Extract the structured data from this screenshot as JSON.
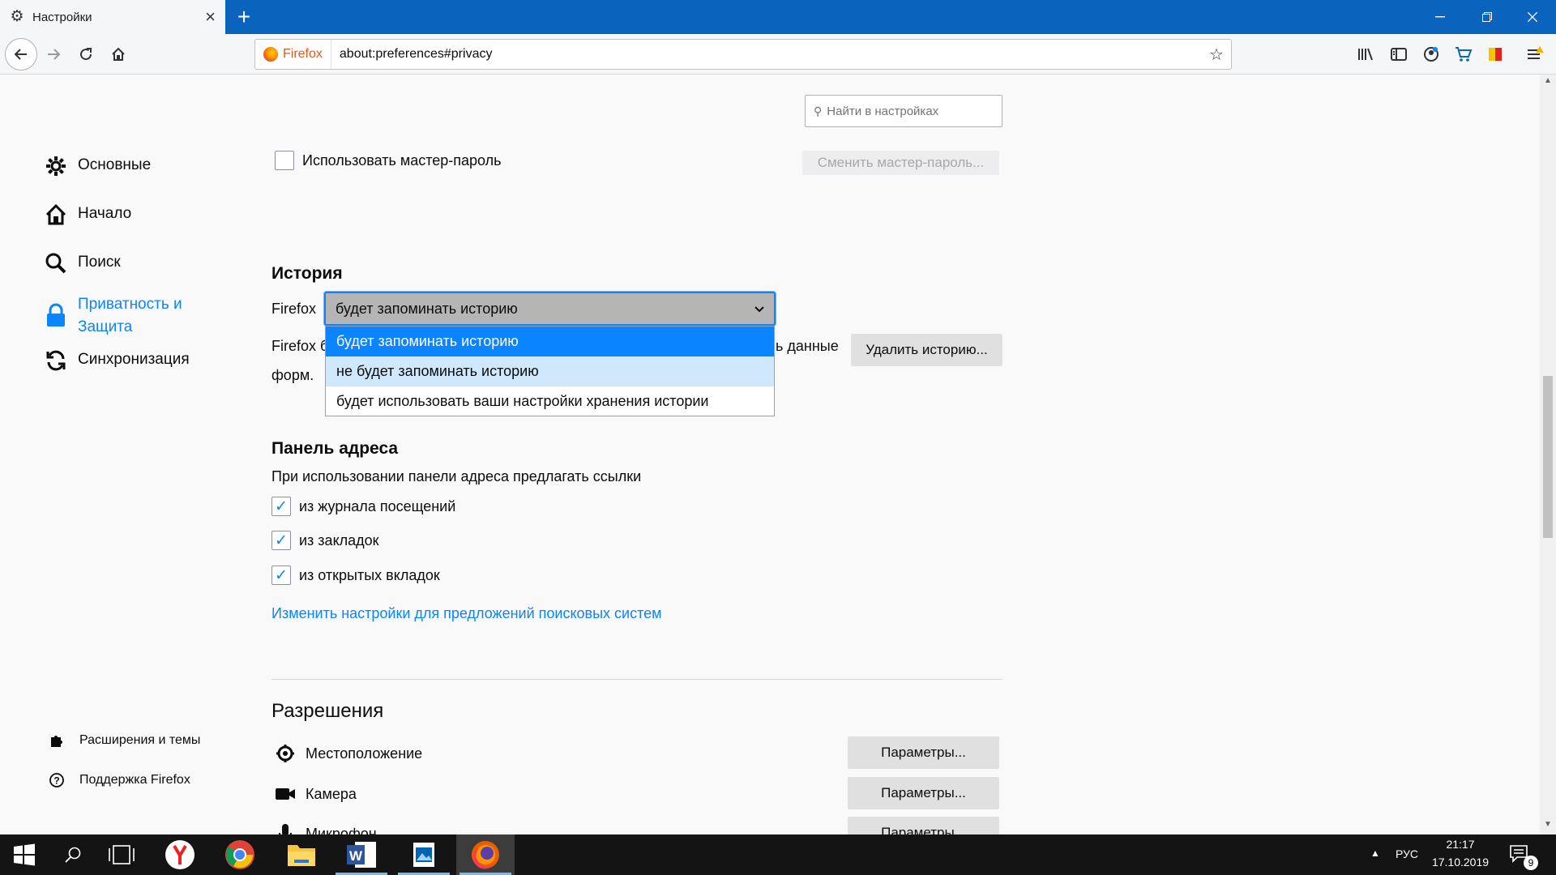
{
  "tab": {
    "title": "Настройки",
    "icon": "gear-icon"
  },
  "urlbar": {
    "identity_label": "Firefox",
    "url": "about:preferences#privacy"
  },
  "search": {
    "placeholder": "Найти в настройках"
  },
  "sidebar": {
    "categories": [
      {
        "label": "Основные",
        "icon": "gear-icon"
      },
      {
        "label": "Начало",
        "icon": "home-icon"
      },
      {
        "label": "Поиск",
        "icon": "search-icon"
      },
      {
        "label": "Приватность и Защита",
        "icon": "lock-icon",
        "selected": true
      },
      {
        "label": "Синхронизация",
        "icon": "sync-icon"
      }
    ],
    "footer": [
      {
        "label": "Расширения и темы",
        "icon": "puzzle-icon"
      },
      {
        "label": "Поддержка Firefox",
        "icon": "help-icon"
      }
    ]
  },
  "master_password": {
    "checkbox_label": "Использовать мастер-пароль",
    "checked": false,
    "change_button": "Сменить мастер-пароль..."
  },
  "history": {
    "heading": "История",
    "prefix": "Firefox",
    "selected": "будет запоминать историю",
    "options": [
      "будет запоминать историю",
      "не будет запоминать историю",
      "будет использовать ваши настройки хранения истории"
    ],
    "description_start": "Firefox б",
    "description_end": "ь данные",
    "description_line2": "форм.",
    "clear_button": "Удалить историю..."
  },
  "address_bar": {
    "heading": "Панель адреса",
    "description": "При использовании панели адреса предлагать ссылки",
    "options": [
      {
        "label": "из журнала посещений",
        "checked": true
      },
      {
        "label": "из закладок",
        "checked": true
      },
      {
        "label": "из открытых вкладок",
        "checked": true
      }
    ],
    "link": "Изменить настройки для предложений поисковых систем"
  },
  "permissions": {
    "heading": "Разрешения",
    "items": [
      {
        "label": "Местоположение",
        "button": "Параметры...",
        "icon": "location-icon"
      },
      {
        "label": "Камера",
        "button": "Параметры...",
        "icon": "camera-icon"
      },
      {
        "label": "Микрофон",
        "button": "Параметры...",
        "icon": "microphone-icon"
      }
    ]
  },
  "taskbar": {
    "language": "РУС",
    "time": "21:17",
    "date": "17.10.2019",
    "notifications": "9"
  },
  "colors": {
    "accent": "#0a84ff",
    "tabstrip": "#0a64bd"
  }
}
